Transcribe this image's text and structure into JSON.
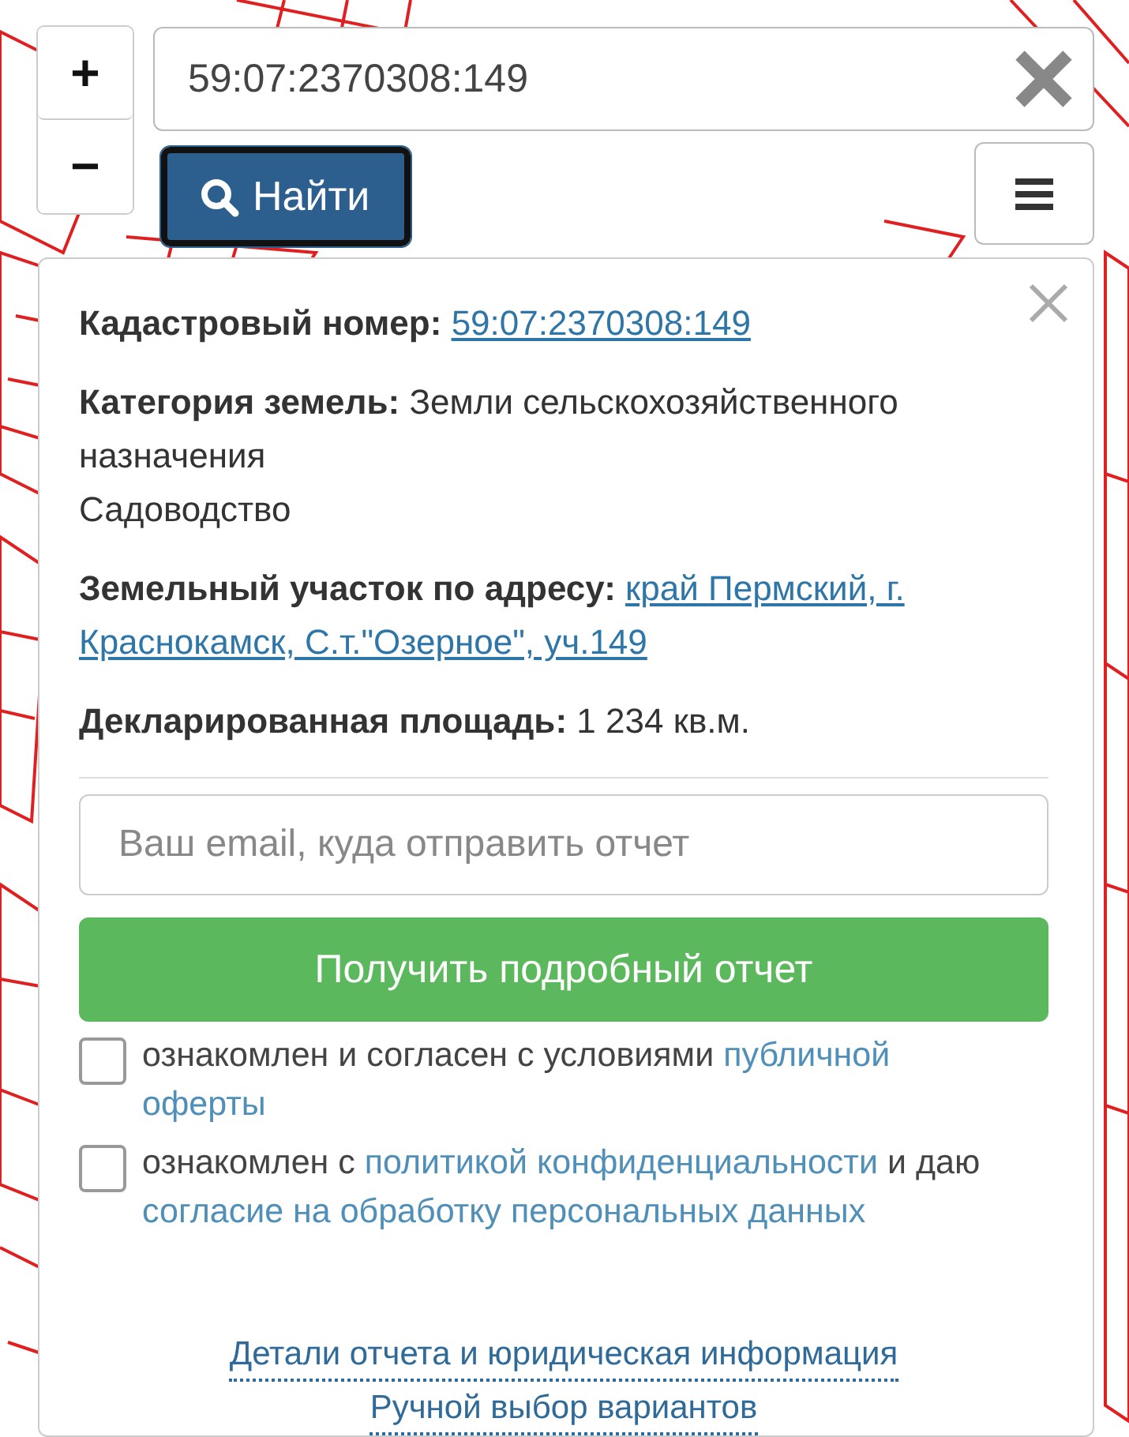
{
  "zoom": {
    "in": "+",
    "out": "−"
  },
  "search": {
    "value": "59:07:2370308:149",
    "button": "Найти"
  },
  "info": [
    {
      "label": "Кадастровый номер:",
      "kind": "link",
      "lines": [
        "59:07:2370308:149"
      ]
    },
    {
      "label": "Категория земель:",
      "kind": "plain",
      "lines": [
        "Земли сельскохозяйственного",
        "назначения",
        "Садоводство"
      ]
    },
    {
      "label": "Земельный участок по адресу:",
      "kind": "link",
      "lines": [
        "край Пермский, г.",
        "Краснокамск, С.т.\"Озерное\", уч.149"
      ]
    },
    {
      "label": "Декларированная площадь:",
      "kind": "plain",
      "lines": [
        "1 234 кв.м."
      ]
    }
  ],
  "email": {
    "placeholder": "Ваш email, куда отправить отчет"
  },
  "submit": "Получить подробный отчет",
  "consents": [
    {
      "checked": false,
      "parts": [
        {
          "kind": "plain",
          "text": "ознакомлен и согласен с условиями "
        },
        {
          "kind": "link",
          "text": "публичной"
        },
        {
          "kind": "break"
        },
        {
          "kind": "link",
          "text": "оферты"
        }
      ]
    },
    {
      "checked": false,
      "parts": [
        {
          "kind": "plain",
          "text": "ознакомлен с "
        },
        {
          "kind": "link",
          "text": "политикой конфиденциальности"
        },
        {
          "kind": "plain",
          "text": " и даю "
        },
        {
          "kind": "link",
          "text": "согласие на обработку персональных данных"
        }
      ]
    }
  ],
  "footer_links": [
    "Детали отчета и юридическая информация",
    "Ручной выбор вариантов"
  ]
}
